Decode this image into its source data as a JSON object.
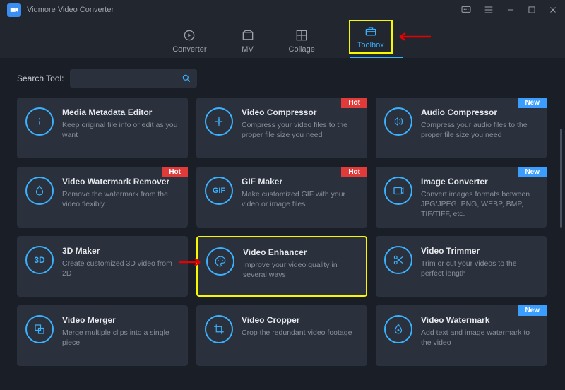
{
  "app": {
    "title": "Vidmore Video Converter"
  },
  "nav": {
    "items": [
      {
        "label": "Converter"
      },
      {
        "label": "MV"
      },
      {
        "label": "Collage"
      },
      {
        "label": "Toolbox"
      }
    ],
    "active": "Toolbox"
  },
  "search": {
    "label": "Search Tool:",
    "placeholder": ""
  },
  "tools": [
    {
      "title": "Media Metadata Editor",
      "desc": "Keep original file info or edit as you want",
      "badge": ""
    },
    {
      "title": "Video Compressor",
      "desc": "Compress your video files to the proper file size you need",
      "badge": "Hot"
    },
    {
      "title": "Audio Compressor",
      "desc": "Compress your audio files to the proper file size you need",
      "badge": "New"
    },
    {
      "title": "Video Watermark Remover",
      "desc": "Remove the watermark from the video flexibly",
      "badge": "Hot"
    },
    {
      "title": "GIF Maker",
      "desc": "Make customized GIF with your video or image files",
      "badge": "Hot"
    },
    {
      "title": "Image Converter",
      "desc": "Convert images formats between JPG/JPEG, PNG, WEBP, BMP, TIF/TIFF, etc.",
      "badge": "New"
    },
    {
      "title": "3D Maker",
      "desc": "Create customized 3D video from 2D",
      "badge": ""
    },
    {
      "title": "Video Enhancer",
      "desc": "Improve your video quality in several ways",
      "badge": ""
    },
    {
      "title": "Video Trimmer",
      "desc": "Trim or cut your videos to the perfect length",
      "badge": ""
    },
    {
      "title": "Video Merger",
      "desc": "Merge multiple clips into a single piece",
      "badge": ""
    },
    {
      "title": "Video Cropper",
      "desc": "Crop the redundant video footage",
      "badge": ""
    },
    {
      "title": "Video Watermark",
      "desc": "Add text and image watermark to the video",
      "badge": "New"
    }
  ],
  "badges": {
    "hot": "Hot",
    "new": "New"
  }
}
